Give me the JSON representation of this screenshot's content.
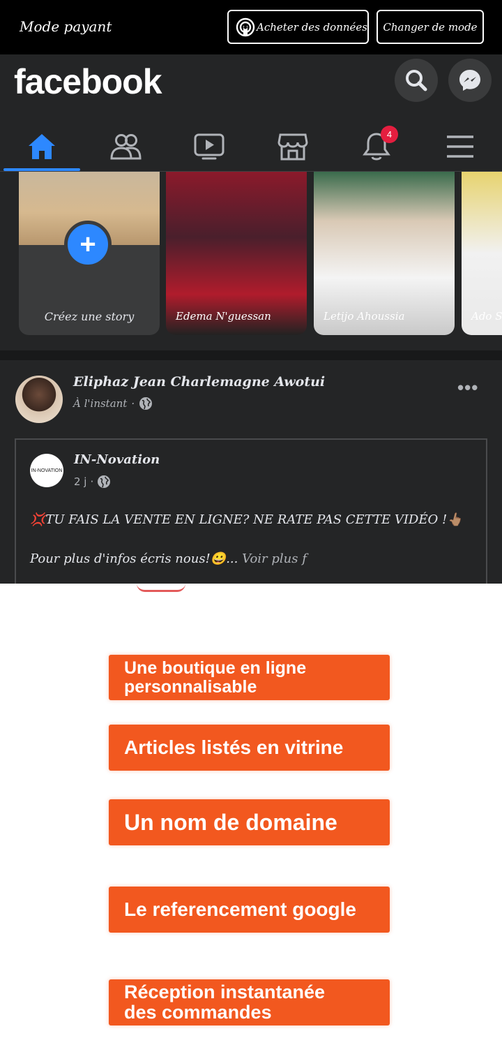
{
  "mode_bar": {
    "label": "Mode payant",
    "buy_data_button": "Acheter des données",
    "change_mode_button": "Changer de mode"
  },
  "header": {
    "logo": "facebook",
    "notification_count": "4"
  },
  "stories": [
    {
      "label": "Créez une story"
    },
    {
      "label": "Edema N'guessan"
    },
    {
      "label": "Letijo Ahoussia"
    },
    {
      "label": "Ado Su"
    }
  ],
  "post": {
    "author": "Eliphaz Jean Charlemagne Awotui",
    "time": "À l'instant",
    "shared": {
      "page_name": "IN-Novation",
      "page_avatar_text": "IN-NOVATION",
      "time": "2 j",
      "text_line1": "💢TU FAIS LA VENTE EN LIGNE? NE RATE PAS CETTE VIDÉO !👆🏽",
      "text_line2": "Pour plus d'infos écris nous!😀...",
      "see_more": "Voir plus f"
    }
  },
  "media": {
    "features": [
      {
        "line1": "Une boutique en ligne",
        "line2": "personnalisable"
      },
      {
        "line1": "Articles listés en vitrine"
      },
      {
        "line1": "Un nom de domaine"
      },
      {
        "line1": "Le referencement google"
      },
      {
        "line1": "Réception instantanée",
        "line2": "des commandes"
      }
    ]
  },
  "colors": {
    "fb_dark": "#242526",
    "accent_blue": "#2d88ff",
    "badge_red": "#e41e3f",
    "feature_orange": "#f2581f"
  },
  "icons": [
    "buy-data-icon",
    "search-icon",
    "messenger-icon",
    "home-icon",
    "friends-icon",
    "video-icon",
    "marketplace-icon",
    "bell-icon",
    "menu-icon",
    "globe-icon",
    "more-icon",
    "plus-icon"
  ]
}
